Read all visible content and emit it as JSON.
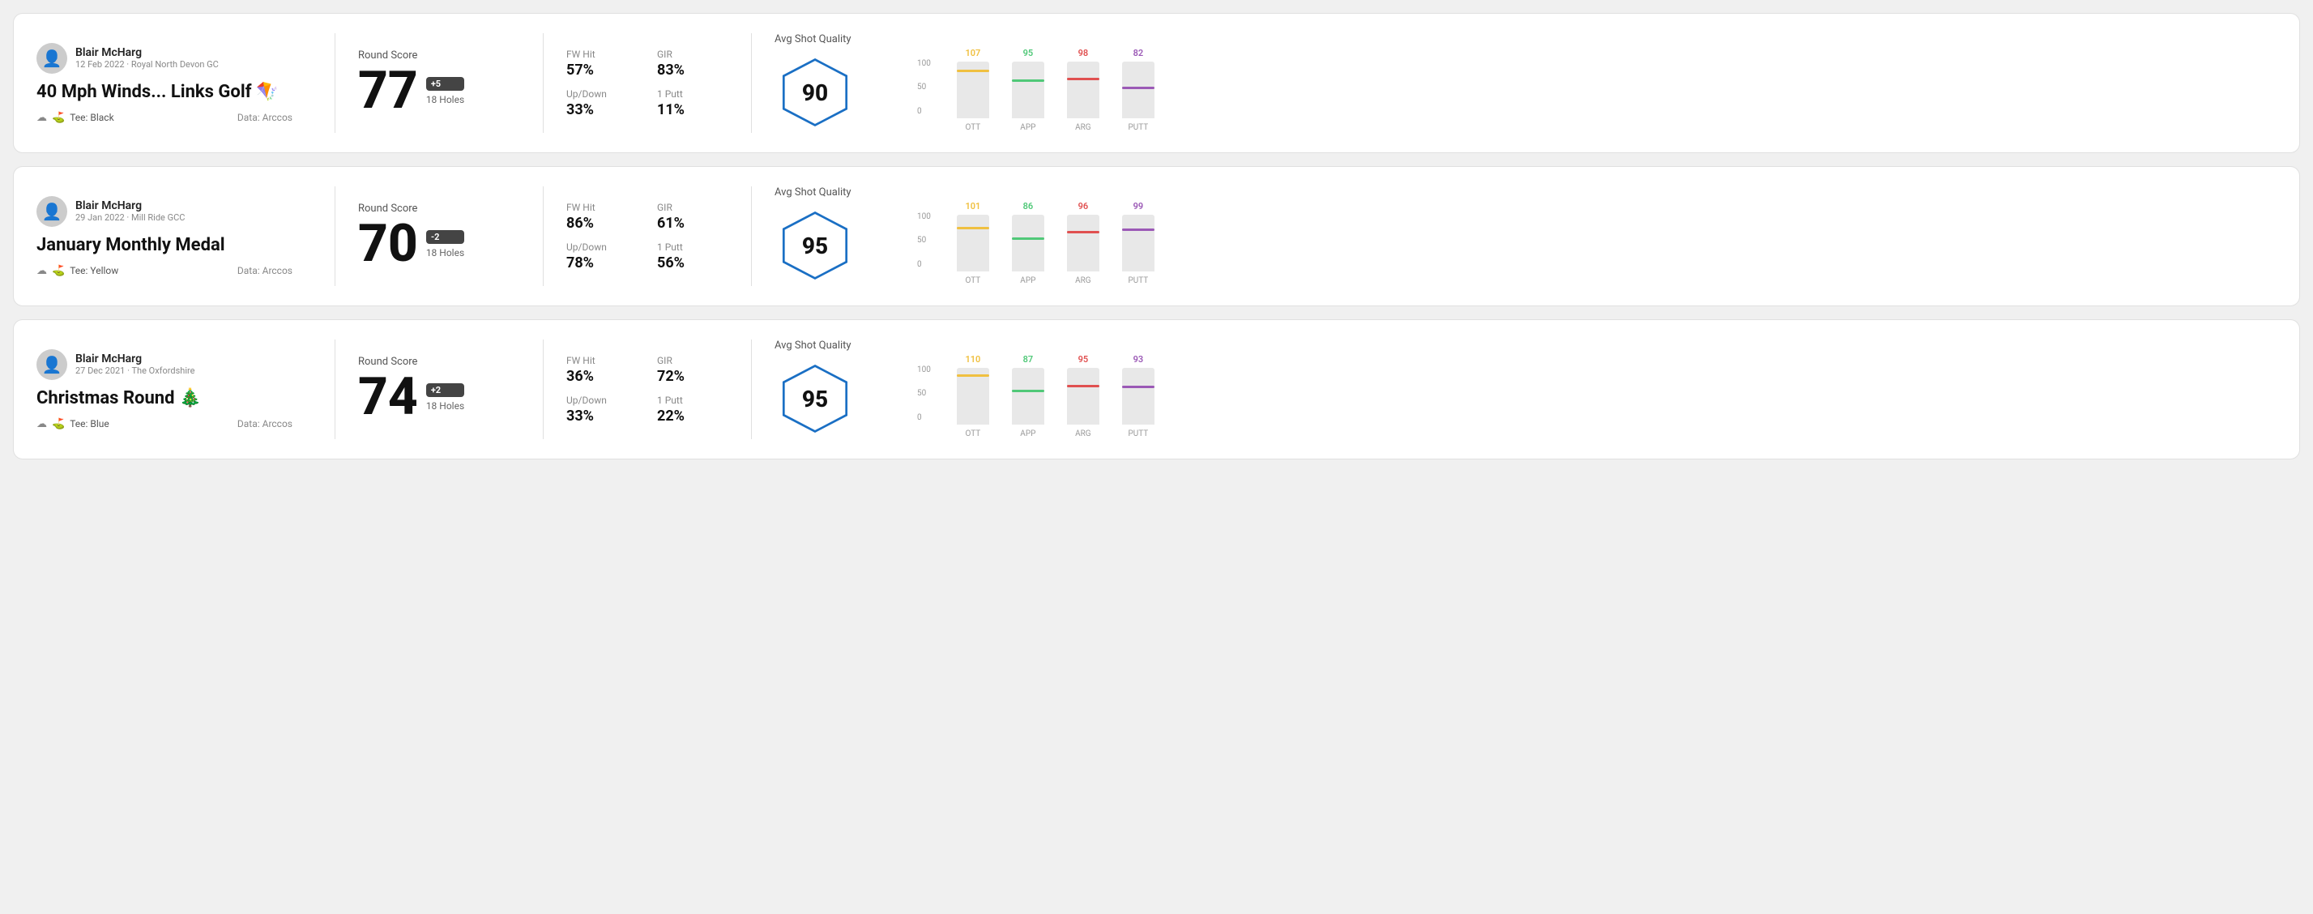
{
  "rounds": [
    {
      "id": "round-1",
      "user": {
        "name": "Blair McHarg",
        "date_course": "12 Feb 2022 · Royal North Devon GC"
      },
      "title": "40 Mph Winds... Links Golf 🪁",
      "tee": "Black",
      "data_source": "Data: Arccos",
      "score": {
        "label": "Round Score",
        "number": "77",
        "badge": "+5",
        "holes": "18 Holes"
      },
      "stats": [
        {
          "label": "FW Hit",
          "value": "57%"
        },
        {
          "label": "GIR",
          "value": "83%"
        },
        {
          "label": "Up/Down",
          "value": "33%"
        },
        {
          "label": "1 Putt",
          "value": "11%"
        }
      ],
      "quality": {
        "label": "Avg Shot Quality",
        "score": "90"
      },
      "chart": {
        "bars": [
          {
            "label": "OTT",
            "value": 107,
            "color": "#f0c040",
            "pct": 85
          },
          {
            "label": "APP",
            "value": 95,
            "color": "#50c878",
            "pct": 68
          },
          {
            "label": "ARG",
            "value": 98,
            "color": "#e05050",
            "pct": 72
          },
          {
            "label": "PUTT",
            "value": 82,
            "color": "#9b59b6",
            "pct": 55
          }
        ]
      }
    },
    {
      "id": "round-2",
      "user": {
        "name": "Blair McHarg",
        "date_course": "29 Jan 2022 · Mill Ride GCC"
      },
      "title": "January Monthly Medal",
      "tee": "Yellow",
      "data_source": "Data: Arccos",
      "score": {
        "label": "Round Score",
        "number": "70",
        "badge": "-2",
        "holes": "18 Holes"
      },
      "stats": [
        {
          "label": "FW Hit",
          "value": "86%"
        },
        {
          "label": "GIR",
          "value": "61%"
        },
        {
          "label": "Up/Down",
          "value": "78%"
        },
        {
          "label": "1 Putt",
          "value": "56%"
        }
      ],
      "quality": {
        "label": "Avg Shot Quality",
        "score": "95"
      },
      "chart": {
        "bars": [
          {
            "label": "OTT",
            "value": 101,
            "color": "#f0c040",
            "pct": 78
          },
          {
            "label": "APP",
            "value": 86,
            "color": "#50c878",
            "pct": 60
          },
          {
            "label": "ARG",
            "value": 96,
            "color": "#e05050",
            "pct": 71
          },
          {
            "label": "PUTT",
            "value": 99,
            "color": "#9b59b6",
            "pct": 75
          }
        ]
      }
    },
    {
      "id": "round-3",
      "user": {
        "name": "Blair McHarg",
        "date_course": "27 Dec 2021 · The Oxfordshire"
      },
      "title": "Christmas Round 🎄",
      "tee": "Blue",
      "data_source": "Data: Arccos",
      "score": {
        "label": "Round Score",
        "number": "74",
        "badge": "+2",
        "holes": "18 Holes"
      },
      "stats": [
        {
          "label": "FW Hit",
          "value": "36%"
        },
        {
          "label": "GIR",
          "value": "72%"
        },
        {
          "label": "Up/Down",
          "value": "33%"
        },
        {
          "label": "1 Putt",
          "value": "22%"
        }
      ],
      "quality": {
        "label": "Avg Shot Quality",
        "score": "95"
      },
      "chart": {
        "bars": [
          {
            "label": "OTT",
            "value": 110,
            "color": "#f0c040",
            "pct": 88
          },
          {
            "label": "APP",
            "value": 87,
            "color": "#50c878",
            "pct": 62
          },
          {
            "label": "ARG",
            "value": 95,
            "color": "#e05050",
            "pct": 70
          },
          {
            "label": "PUTT",
            "value": 93,
            "color": "#9b59b6",
            "pct": 68
          }
        ]
      }
    }
  ],
  "labels": {
    "tee_prefix": "Tee:",
    "y_axis": [
      "100",
      "50",
      "0"
    ]
  }
}
